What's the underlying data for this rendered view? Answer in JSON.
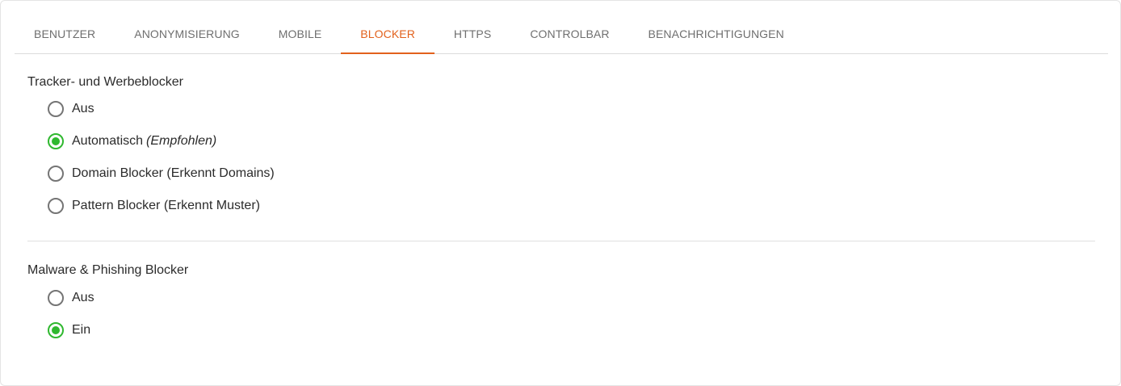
{
  "tabs": [
    {
      "label": "BENUTZER",
      "active": false
    },
    {
      "label": "ANONYMISIERUNG",
      "active": false
    },
    {
      "label": "MOBILE",
      "active": false
    },
    {
      "label": "BLOCKER",
      "active": true
    },
    {
      "label": "HTTPS",
      "active": false
    },
    {
      "label": "CONTROLBAR",
      "active": false
    },
    {
      "label": "BENACHRICHTIGUNGEN",
      "active": false
    }
  ],
  "tracker": {
    "title": "Tracker- und Werbeblocker",
    "options": [
      {
        "label": "Aus",
        "hint": "",
        "checked": false
      },
      {
        "label": "Automatisch",
        "hint": "(Empfohlen)",
        "checked": true
      },
      {
        "label": "Domain Blocker (Erkennt Domains)",
        "hint": "",
        "checked": false
      },
      {
        "label": "Pattern Blocker (Erkennt Muster)",
        "hint": "",
        "checked": false
      }
    ]
  },
  "malware": {
    "title": "Malware & Phishing Blocker",
    "options": [
      {
        "label": "Aus",
        "checked": false
      },
      {
        "label": "Ein",
        "checked": true
      }
    ]
  },
  "colors": {
    "accent": "#e2611c",
    "radio_checked": "#2fb82f",
    "radio_unchecked": "#757575",
    "tab_text": "#6f6f6f",
    "text": "#2b2b2b"
  }
}
